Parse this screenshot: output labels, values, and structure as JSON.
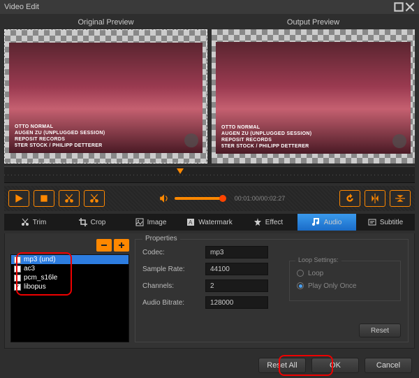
{
  "window": {
    "title": "Video Edit"
  },
  "previews": {
    "left_label": "Original Preview",
    "right_label": "Output Preview",
    "overlay_line1": "OTTO NORMAL",
    "overlay_line2": "AUGEN ZU (UNPLUGGED SESSION)",
    "overlay_line3": "REPOSIT RECORDS",
    "overlay_line4": "5TER STOCK / PHILIPP DETTERER"
  },
  "transport": {
    "timecode": "00:01:00/00:02:27"
  },
  "tabs": {
    "trim": "Trim",
    "crop": "Crop",
    "image": "Image",
    "watermark": "Watermark",
    "effect": "Effect",
    "audio": "Audio",
    "subtitle": "Subtitle"
  },
  "audio_list": {
    "items": [
      {
        "label": "mp3 (und)",
        "checked": false,
        "selected": true
      },
      {
        "label": "ac3",
        "checked": false,
        "selected": false
      },
      {
        "label": "pcm_s16le",
        "checked": false,
        "selected": false
      },
      {
        "label": "libopus",
        "checked": true,
        "selected": false
      }
    ]
  },
  "properties": {
    "title": "Properties",
    "codec_label": "Codec:",
    "codec_value": "mp3",
    "samplerate_label": "Sample Rate:",
    "samplerate_value": "44100",
    "channels_label": "Channels:",
    "channels_value": "2",
    "bitrate_label": "Audio Bitrate:",
    "bitrate_value": "128000"
  },
  "loop": {
    "title": "Loop Settings:",
    "opt_loop": "Loop",
    "opt_once": "Play Only Once",
    "selected": "once"
  },
  "buttons": {
    "reset": "Reset",
    "reset_all": "Reset All",
    "ok": "OK",
    "cancel": "Cancel"
  }
}
